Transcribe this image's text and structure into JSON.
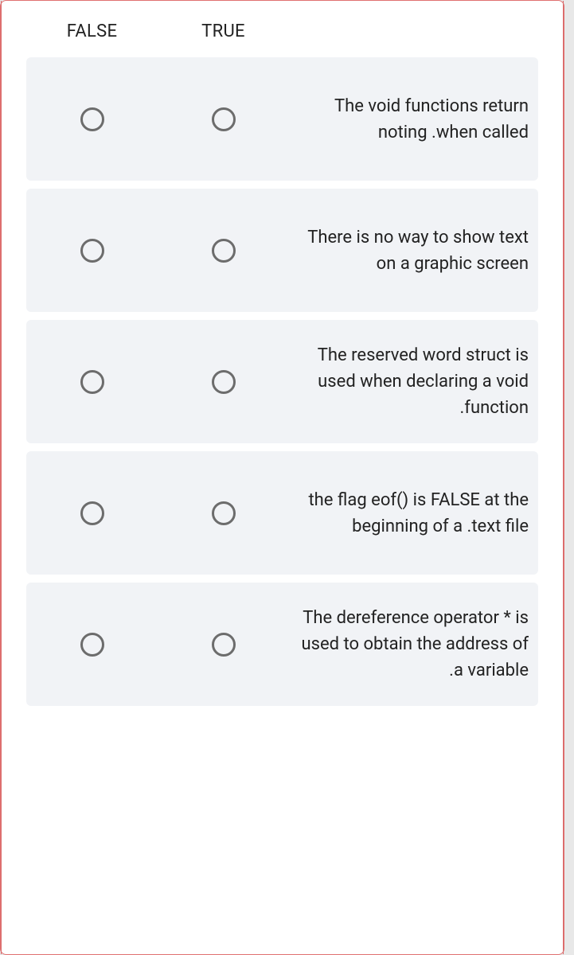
{
  "headers": {
    "false": "FALSE",
    "true": "TRUE"
  },
  "questions": [
    {
      "text": "The void functions return noting .when called"
    },
    {
      "text": "There is no way to show text on a graphic screen"
    },
    {
      "text": "The reserved word struct is used when declaring a void .function"
    },
    {
      "text": "the flag eof() is FALSE at the beginning of a .text file"
    },
    {
      "text": "The dereference operator * is used to obtain the address of .a variable"
    }
  ]
}
